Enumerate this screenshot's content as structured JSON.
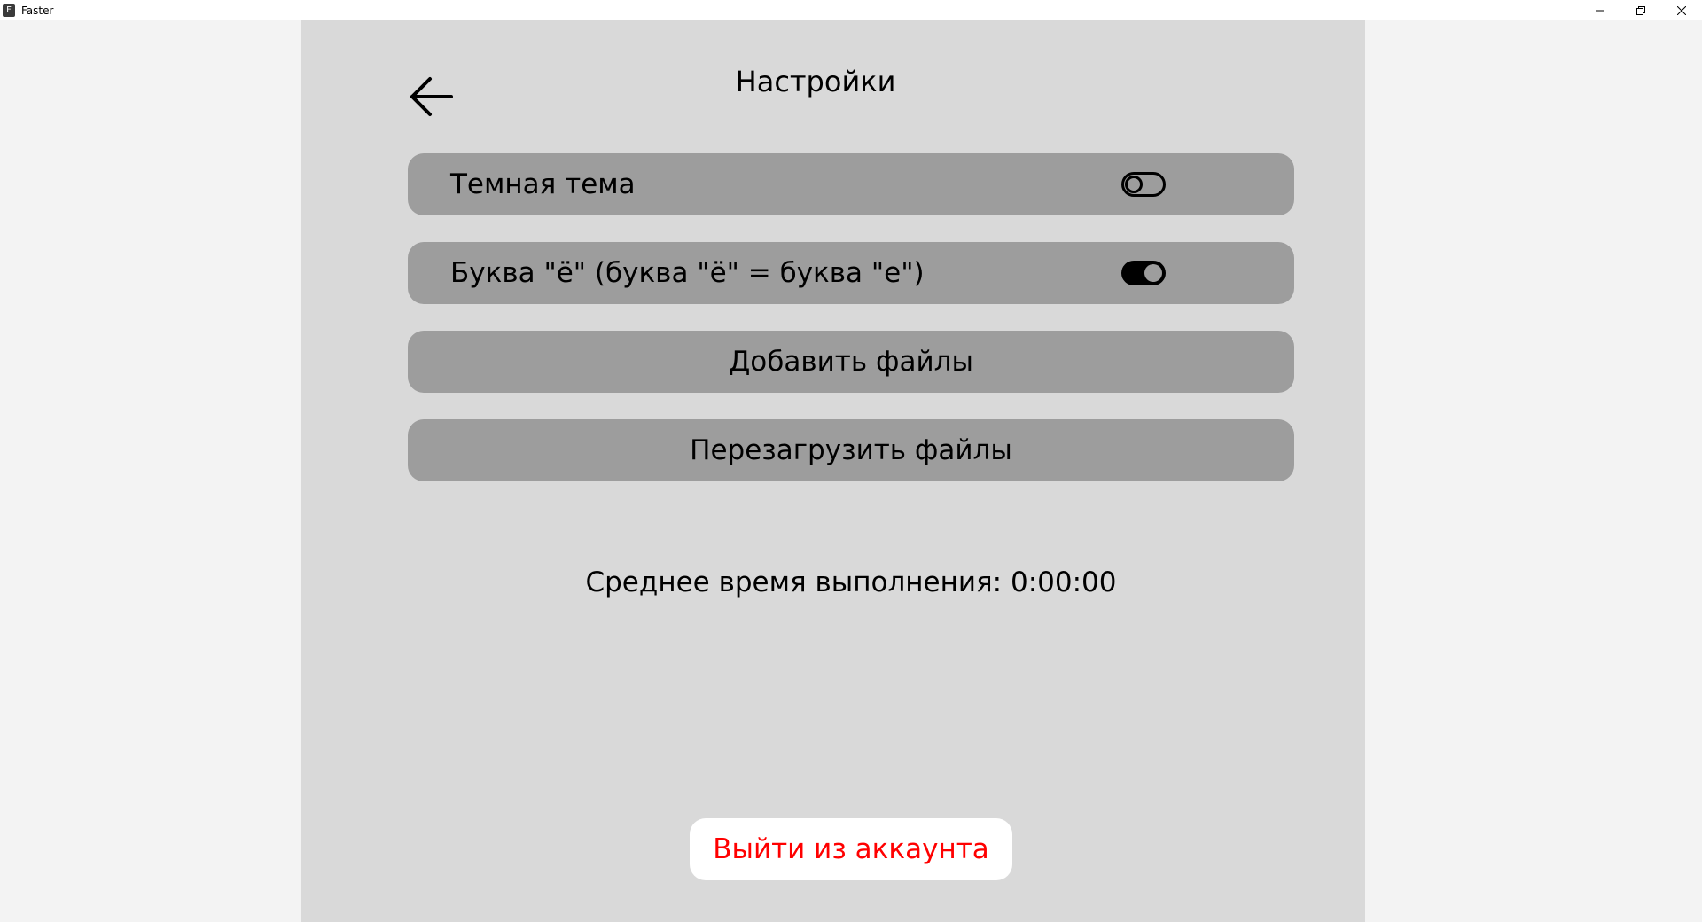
{
  "window": {
    "title": "Faster",
    "icon_letter": "F"
  },
  "header": {
    "title": "Настройки",
    "back_icon": "arrow-left-icon"
  },
  "settings": {
    "dark_theme": {
      "label": "Темная тема",
      "enabled": false
    },
    "yo_letter": {
      "label": "Буква \"ё\" (буква \"ё\" = буква \"е\")",
      "enabled": true
    },
    "add_files_label": "Добавить файлы",
    "reload_files_label": "Перезагрузить файлы"
  },
  "stats": {
    "avg_time_text": "Среднее время выполнения: 0:00:00"
  },
  "logout": {
    "label": "Выйти из аккаунта",
    "color": "#ff0000"
  },
  "colors": {
    "panel_bg": "#d9d9d9",
    "row_bg": "#9d9d9d",
    "page_bg": "#f3f3f3"
  }
}
